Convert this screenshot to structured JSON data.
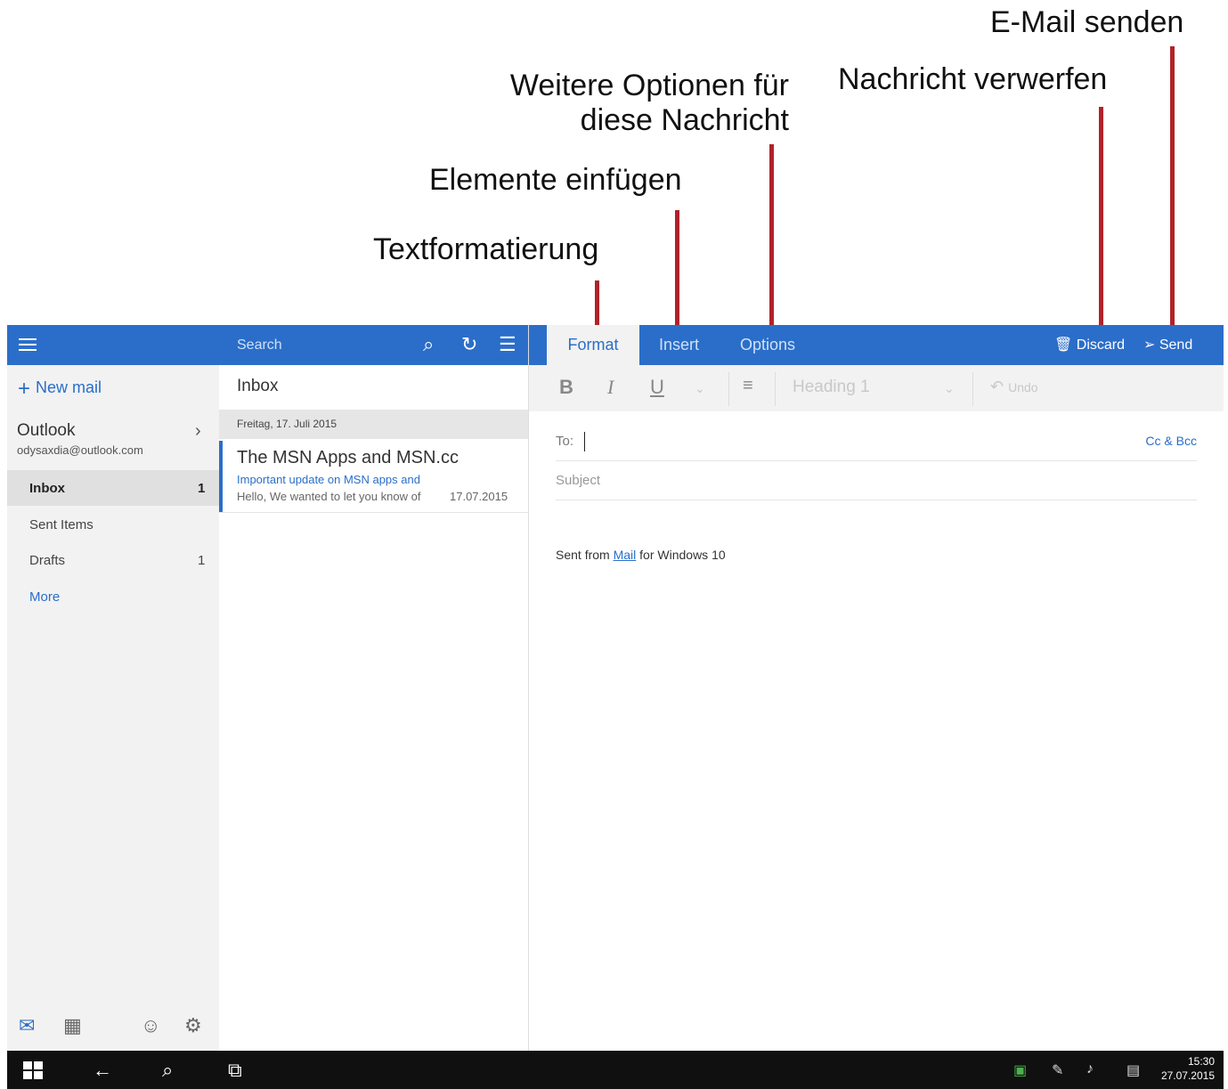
{
  "annotations": {
    "send": "E-Mail senden",
    "discard": "Nachricht verwerfen",
    "options": "Weitere Optionen für diese Nachricht",
    "insert": "Elemente einfügen",
    "format": "Textformatierung"
  },
  "nav": {
    "new_mail": "New mail",
    "account_name": "Outlook",
    "account_email": "odysaxdia@outlook.com",
    "folders": [
      {
        "label": "Inbox",
        "count": "1"
      },
      {
        "label": "Sent Items",
        "count": ""
      },
      {
        "label": "Drafts",
        "count": "1"
      }
    ],
    "more": "More"
  },
  "list": {
    "search_placeholder": "Search",
    "header": "Inbox",
    "date_group": "Freitag, 17. Juli 2015",
    "message": {
      "from": "The MSN Apps and MSN.cc",
      "subject": "Important update on MSN apps and",
      "preview": "Hello, We wanted to let you know of",
      "date": "17.07.2015"
    }
  },
  "compose": {
    "tabs": [
      "Format",
      "Insert",
      "Options"
    ],
    "discard": "Discard",
    "send": "Send",
    "toolbar": {
      "bold": "B",
      "italic": "I",
      "underline": "U",
      "style": "Heading 1",
      "undo": "Undo"
    },
    "to_label": "To:",
    "cc_bcc": "Cc & Bcc",
    "subject_placeholder": "Subject",
    "signature_prefix": "Sent from ",
    "signature_link": "Mail",
    "signature_suffix": " for Windows 10"
  },
  "taskbar": {
    "time": "15:30",
    "date": "27.07.2015"
  },
  "colors": {
    "accent": "#2b6ec9",
    "annotation_line": "#b1222a",
    "taskbar": "#101010"
  },
  "icons": [
    "hamburger-icon",
    "plus-icon",
    "chevron-right-icon",
    "search-icon",
    "sync-icon",
    "filter-icon",
    "trash-icon",
    "send-icon",
    "mail-icon",
    "calendar-icon",
    "smiley-icon",
    "gear-icon",
    "windows-icon",
    "back-icon",
    "cortana-icon",
    "task-view-icon"
  ]
}
